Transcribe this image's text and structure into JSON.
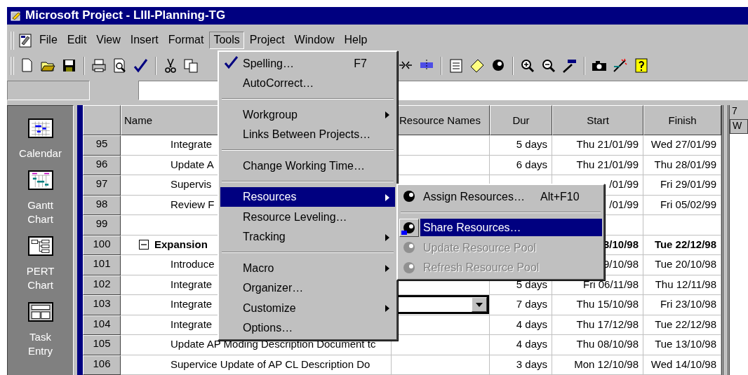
{
  "window": {
    "title": "Microsoft Project - LIII-Planning-TG"
  },
  "menu_bar": [
    {
      "label": "File",
      "selected": false
    },
    {
      "label": "Edit",
      "selected": false
    },
    {
      "label": "View",
      "selected": false
    },
    {
      "label": "Insert",
      "selected": false
    },
    {
      "label": "Format",
      "selected": false
    },
    {
      "label": "Tools",
      "selected": true
    },
    {
      "label": "Project",
      "selected": false
    },
    {
      "label": "Window",
      "selected": false
    },
    {
      "label": "Help",
      "selected": false
    }
  ],
  "view_bar": [
    {
      "label": "Calendar",
      "kind": "calendar"
    },
    {
      "label": "Gantt Chart",
      "kind": "gantt"
    },
    {
      "label": "PERT Chart",
      "kind": "pert"
    },
    {
      "label": "Task Entry",
      "kind": "entry"
    }
  ],
  "table": {
    "columns": [
      "Name",
      "Resource Names",
      "Dur",
      "Start",
      "Finish"
    ],
    "timescale": [
      "7",
      "W"
    ],
    "rows": [
      {
        "id": "95",
        "kind": "task",
        "name": "Integrate",
        "dur": "5 days",
        "start": "Thu 21/01/99",
        "finish": "Wed 27/01/99",
        "editing": false
      },
      {
        "id": "96",
        "kind": "task",
        "name": "Update A",
        "dur": "6 days",
        "start": "Thu 21/01/99",
        "finish": "Thu 28/01/99",
        "editing": false
      },
      {
        "id": "97",
        "kind": "task",
        "name": "Supervis",
        "start": "/01/99",
        "finish": "Fri 29/01/99"
      },
      {
        "id": "98",
        "kind": "task",
        "name": "Review F",
        "start": "/01/99",
        "finish": "Fri 05/02/99"
      },
      {
        "id": "99",
        "kind": "blank"
      },
      {
        "id": "100",
        "kind": "summary",
        "expanded": true,
        "name": "Expansion",
        "start": "3/10/98",
        "finish": "Tue 22/12/98",
        "editing": false
      },
      {
        "id": "101",
        "kind": "task",
        "name": "Introduce",
        "start": "9/10/98",
        "finish": "Tue 20/10/98"
      },
      {
        "id": "102",
        "kind": "task",
        "name": "Integrate",
        "dur": "5 days",
        "start": "Fri 06/11/98",
        "finish": "Thu 12/11/98",
        "editing": false
      },
      {
        "id": "103",
        "kind": "task",
        "name": "Integrate",
        "dur": "7 days",
        "start": "Thu 15/10/98",
        "finish": "Fri 23/10/98",
        "editing": true
      },
      {
        "id": "104",
        "kind": "task",
        "name": "Integrate",
        "dur": "4 days",
        "start": "Thu 17/12/98",
        "finish": "Tue 22/12/98",
        "editing": false
      },
      {
        "id": "105",
        "kind": "task",
        "name": "Update AP Moding Description Document tc",
        "dur": "4 days",
        "start": "Thu 08/10/98",
        "finish": "Tue 13/10/98",
        "editing": false
      },
      {
        "id": "106",
        "kind": "task",
        "name": "Supervice Update of AP CL Description Do",
        "dur": "3 days",
        "start": "Mon 12/10/98",
        "finish": "Wed 14/10/98",
        "editing": false
      }
    ]
  },
  "tools_menu": [
    {
      "kind": "item",
      "label": "Spelling…",
      "shortcut": "F7",
      "submenu": false,
      "selected": false
    },
    {
      "kind": "item",
      "label": "AutoCorrect…",
      "submenu": false,
      "selected": false
    },
    {
      "kind": "separator"
    },
    {
      "kind": "item",
      "label": "Workgroup",
      "submenu": true,
      "selected": false
    },
    {
      "kind": "item",
      "label": "Links Between Projects…",
      "submenu": false,
      "selected": false
    },
    {
      "kind": "separator"
    },
    {
      "kind": "item",
      "label": "Change Working Time…",
      "submenu": false,
      "selected": false
    },
    {
      "kind": "separator"
    },
    {
      "kind": "item",
      "label": "Resources",
      "submenu": true,
      "selected": true
    },
    {
      "kind": "item",
      "label": "Resource Leveling…",
      "submenu": false,
      "selected": false
    },
    {
      "kind": "item",
      "label": "Tracking",
      "submenu": true,
      "selected": false
    },
    {
      "kind": "separator"
    },
    {
      "kind": "item",
      "label": "Macro",
      "submenu": true,
      "selected": false
    },
    {
      "kind": "item",
      "label": "Organizer…",
      "submenu": false,
      "selected": false
    },
    {
      "kind": "item",
      "label": "Customize",
      "submenu": true,
      "selected": false
    },
    {
      "kind": "item",
      "label": "Options…",
      "submenu": false,
      "selected": false
    }
  ],
  "resources_submenu": [
    {
      "kind": "item",
      "label": "Assign Resources…",
      "shortcut": "Alt+F10",
      "selected": false,
      "disabled": false
    },
    {
      "kind": "separator"
    },
    {
      "kind": "item",
      "label": "Share Resources…",
      "selected": true,
      "disabled": false
    },
    {
      "kind": "item",
      "label": "Update Resource Pool",
      "selected": false,
      "disabled": true
    },
    {
      "kind": "item",
      "label": "Refresh Resource Pool",
      "selected": false,
      "disabled": true
    }
  ]
}
